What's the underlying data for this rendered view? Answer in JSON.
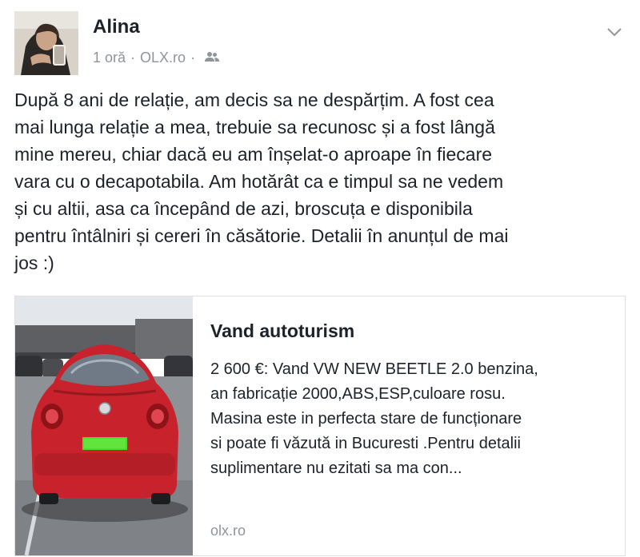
{
  "post": {
    "author": "Alina",
    "time": "1 oră",
    "separator": "·",
    "source": "OLX.ro",
    "audience_icon": "friends-icon",
    "menu_icon": "chevron-down-icon",
    "text_lines": [
      "După 8 ani de relație, am decis sa ne despărțim. A fost cea",
      "mai lunga relație a mea, trebuie sa recunosc și a fost lângă",
      "mine mereu, chiar dacă eu am înșelat-o aproape în fiecare",
      "vara cu o decapotabila. Am hotărât ca e timpul sa ne vedem",
      "și cu altii, asa ca începând de azi, broscuța e disponibila",
      "pentru întâlniri și cereri în căsătorie. Detalii în anunțul de mai",
      "jos :)"
    ]
  },
  "link": {
    "title": "Vand autoturism",
    "description_lines": [
      "2 600 €: Vand VW NEW BEETLE 2.0 benzina,",
      "an fabricație 2000,ABS,ESP,culoare rosu.",
      "Masina este in perfecta stare de funcționare",
      "si poate fi văzută in Bucuresti .Pentru detalii",
      "suplimentare nu ezitati sa ma con..."
    ],
    "domain": "olx.ro",
    "image_subject": "red VW New Beetle parked in a lot, rear view",
    "car_color": "#c8232c"
  },
  "colors": {
    "text": "#1d2129",
    "meta": "#90949c",
    "border": "#dddfe2",
    "plate": "#4fdc2a"
  }
}
